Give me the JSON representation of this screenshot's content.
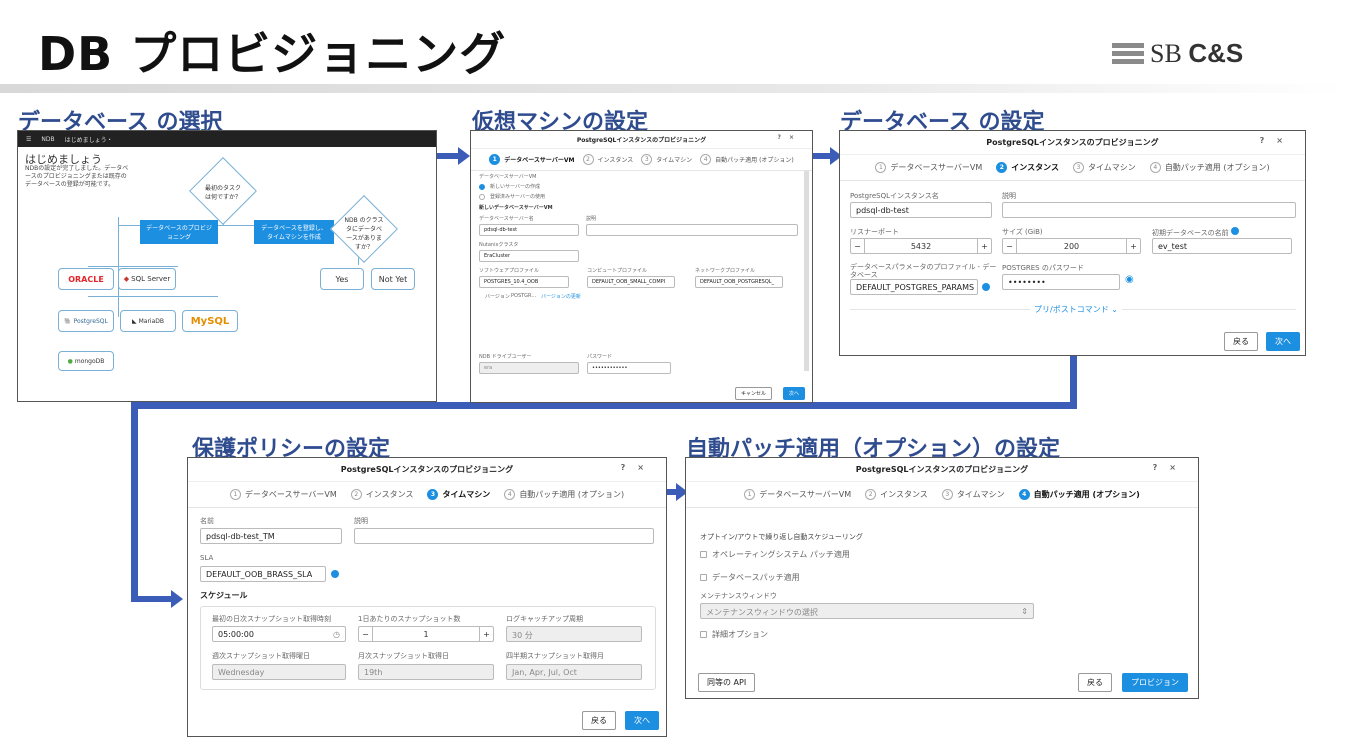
{
  "slide": {
    "title": "DB プロビジョニング",
    "logo_text": "SB",
    "logo_bold": "C&S"
  },
  "labels": {
    "s1": "データベース の選択",
    "s2": "仮想マシンの設定",
    "s3": "データベース の設定",
    "s4": "保護ポリシーの設定",
    "s5": "自動パッチ適用（オプション）の設定"
  },
  "shot1": {
    "topbar_brand": "NDB",
    "topbar_tab": "はじめましょう・",
    "heading": "はじめましょう",
    "intro": "NDBの設定が完了しました。データベースのプロビジョニングまたは既存のデータベースの登録が可能です。",
    "q1": "最初のタスクは何ですか？",
    "tag_left": "データベースのプロビジョニング",
    "tag_right": "データベースを登録し、タイムマシンを作成",
    "q2": "NDB のクラスタにデータベースがありますか？",
    "yes": "Yes",
    "not_yet": "Not Yet",
    "oracle": "ORACLE",
    "sqlserver": "SQL Server",
    "postgres": "PostgreSQL",
    "mariadb": "MariaDB",
    "mysql": "MySQL",
    "mongodb": "mongoDB"
  },
  "dialog": {
    "title": "PostgreSQLインスタンスのプロビジョニング",
    "step1": "データベースサーバーVM",
    "step2": "インスタンス",
    "step3": "タイムマシン",
    "step4": "自動パッチ適用 (オプション)",
    "back": "戻る",
    "next": "次へ",
    "cancel": "キャンセル",
    "provision": "プロビジョン"
  },
  "shot2": {
    "section": "データベースサーバーVM",
    "radio_new": "新しいサーバーの作成",
    "radio_existing": "登録済みサーバーの使用",
    "new_server": "新しいデータベースサーバーVM",
    "name_label": "データベースサーバー名",
    "name_value": "pdsql-db-test",
    "desc_label": "説明",
    "cluster_label": "Nutanixクラスタ",
    "cluster_value": "EraCluster",
    "sw_label": "ソフトウェアプロファイル",
    "sw_value": "POSTGRES_10.4_OOB",
    "compute_label": "コンピュートプロファイル",
    "compute_value": "DEFAULT_OOB_SMALL_COMPI",
    "net_label": "ネットワークプロファイル",
    "net_value": "DEFAULT_OOB_POSTGRESQL_",
    "version_label": "バージョン",
    "version_value": "POSTGR...",
    "version_update": "バージョンの更新",
    "driver_label": "NDB ドライブユーザー",
    "driver_value": "era",
    "pw_label": "パスワード",
    "pw_value": "••••••••••••"
  },
  "shot3": {
    "inst_label": "PostgreSQLインスタンス名",
    "inst_value": "pdsql-db-test",
    "desc_label": "説明",
    "port_label": "リスナーポート",
    "port_value": "5432",
    "size_label": "サイズ (GiB)",
    "size_value": "200",
    "dbname_label": "初期データベースの名前",
    "dbname_value": "ev_test",
    "param_label": "データベースパラメータのプロファイル - データベース",
    "param_value": "DEFAULT_POSTGRES_PARAMS",
    "pw_label": "POSTGRES のパスワード",
    "pw_value": "••••••••",
    "postcmd": "プリ/ポストコマンド"
  },
  "shot4": {
    "name_label": "名前",
    "name_value": "pdsql-db-test_TM",
    "desc_label": "説明",
    "sla_label": "SLA",
    "sla_value": "DEFAULT_OOB_BRASS_SLA",
    "schedule": "スケジュール",
    "first_label": "最初の日次スナップショット取得時刻",
    "first_value": "05:00:00",
    "perday_label": "1日あたりのスナップショット数",
    "perday_value": "1",
    "logcatch_label": "ログキャッチアップ周期",
    "logcatch_value": "30 分",
    "weekly_label": "週次スナップショット取得曜日",
    "weekly_value": "Wednesday",
    "monthly_label": "月次スナップショット取得日",
    "monthly_value": "19th",
    "quarter_label": "四半期スナップショット取得月",
    "quarter_value": "Jan, Apr, Jul, Oct"
  },
  "shot5": {
    "optin": "オプトイン/アウトで繰り返し自動スケジューリング",
    "os_patch": "オペレーティングシステム パッチ適用",
    "db_patch": "データベースパッチ適用",
    "mw_label": "メンテナンスウィンドウ",
    "mw_value": "メンテナンスウィンドウの選択",
    "detail": "詳細オプション",
    "api": "同等の API"
  }
}
